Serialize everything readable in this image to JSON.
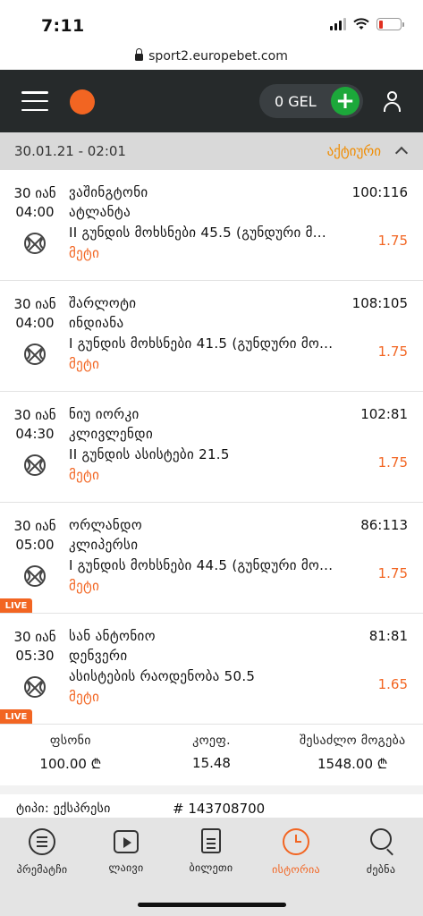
{
  "status_bar": {
    "time": "7:11"
  },
  "browser": {
    "url": "sport2.europebet.com"
  },
  "header": {
    "balance": "0 GEL",
    "add_symbol": "+"
  },
  "date_row": {
    "date": "30.01.21 - 02:01",
    "status": "აქტიური"
  },
  "bets": [
    {
      "date": "30 იან",
      "time": "04:00",
      "team1": "ვაშინგტონი",
      "team2": "ატლანტა",
      "market": "II გუნდის მოხსნები 45.5 (გუნდური მ...",
      "selection": "მეტი",
      "score": "100:116",
      "odds": "1.75",
      "live": ""
    },
    {
      "date": "30 იან",
      "time": "04:00",
      "team1": "შარლოტი",
      "team2": "ინდიანა",
      "market": "I გუნდის მოხსნები 41.5 (გუნდური მო...",
      "selection": "მეტი",
      "score": "108:105",
      "odds": "1.75",
      "live": ""
    },
    {
      "date": "30 იან",
      "time": "04:30",
      "team1": "ნიუ იორკი",
      "team2": "კლივლენდი",
      "market": "II გუნდის ასისტები 21.5",
      "selection": "მეტი",
      "score": "102:81",
      "odds": "1.75",
      "live": ""
    },
    {
      "date": "30 იან",
      "time": "05:00",
      "team1": "ორლანდო",
      "team2": "კლიპერსი",
      "market": "I გუნდის მოხსნები 44.5 (გუნდური მო...",
      "selection": "მეტი",
      "score": "86:113",
      "odds": "1.75",
      "live": "LIVE"
    },
    {
      "date": "30 იან",
      "time": "05:30",
      "team1": "სან ანტონიო",
      "team2": "დენვერი",
      "market": "ასისტების რაოდენობა 50.5",
      "selection": "მეტი",
      "score": "81:81",
      "odds": "1.65",
      "live": "LIVE"
    }
  ],
  "summary": {
    "stake_label": "ფსონი",
    "stake_value": "100.00 ₾",
    "odds_label": "კოეფ.",
    "odds_value": "15.48",
    "win_label": "შესაძლო მოგება",
    "win_value": "1548.00 ₾"
  },
  "ticket": {
    "type": "ტიპი: ექსპრესი",
    "number": "# 143708700"
  },
  "nav": [
    {
      "label": "პრემატჩი"
    },
    {
      "label": "ლაივი"
    },
    {
      "label": "ბილეთი"
    },
    {
      "label": "ისტორია"
    },
    {
      "label": "ძებნა"
    }
  ]
}
